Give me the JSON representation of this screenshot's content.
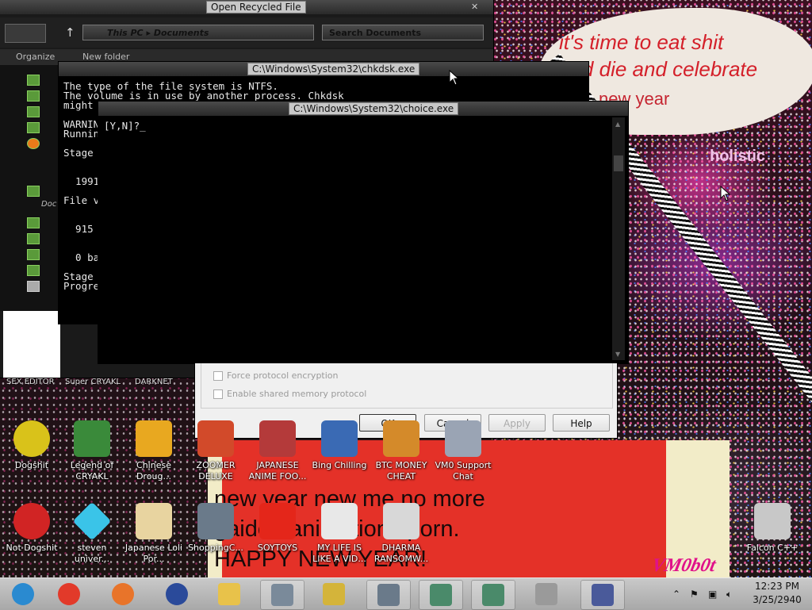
{
  "wallpaper": {
    "bubble_line1": "it's time to eat shit",
    "bubble_line2": "and die and celebrate",
    "bubble_line3": "new year",
    "holistic": "holistic",
    "sign_line1": "new year new me no more",
    "sign_line2": "gaiden animations porn.",
    "sign_line3": "HAPPY NEW YEAR!",
    "watermark": "VM0b0t"
  },
  "explorer": {
    "title": "Open Recycled File",
    "path_this_pc": "This PC",
    "path_sep": "▸",
    "path_documents": "Documents",
    "search_placeholder": "Search Documents",
    "organize": "Organize",
    "new_folder": "New folder",
    "nav_docs_label": "Doc"
  },
  "chkdsk": {
    "title": "C:\\Windows\\System32\\chkdsk.exe",
    "lines": [
      "The type of the file system is NTFS.",
      "The volume is in use by another process. Chkdsk",
      "might",
      "",
      "WARNIN",
      "Runnin",
      "",
      "Stage",
      "",
      "",
      "  1991",
      "",
      "File v",
      "",
      "",
      "  915",
      "",
      "",
      "  0 ba",
      "",
      "Stage",
      "Progre"
    ]
  },
  "choice": {
    "title": "C:\\Windows\\System32\\choice.exe",
    "prompt": "[Y,N]?_"
  },
  "dialog": {
    "options": [
      {
        "label": "Force protocol encryption",
        "checked": false
      },
      {
        "label": "Enable shared memory protocol",
        "checked": false
      }
    ],
    "ok": "OK",
    "cancel": "Cancel",
    "apply": "Apply",
    "help": "Help"
  },
  "desktop": {
    "hidden_row_labels": [
      "SEX EDITOR",
      "Super CRYAKL",
      "DARKNET"
    ],
    "icons": [
      {
        "label": "Dogshit",
        "icon": "dogshit-disc-icon",
        "color": "#d9c21a"
      },
      {
        "label": "Legend of CRYAKL",
        "icon": "pixel-character-icon",
        "color": "#3a8a3a"
      },
      {
        "label": "Chinese Droug...",
        "icon": "mahjong-tile-icon",
        "color": "#e8a820"
      },
      {
        "label": "ZOOMER DELUXE",
        "icon": "zoomer-icon",
        "color": "#d24a2a"
      },
      {
        "label": "JAPANESE ANIME FOO...",
        "icon": "anime-food-icon",
        "color": "#b43a3a"
      },
      {
        "label": "Bing Chilling",
        "icon": "bing-icon",
        "color": "#3a6ab4"
      },
      {
        "label": "BTC MONEY CHEAT",
        "icon": "bitcoin-icon",
        "color": "#d48a2a"
      },
      {
        "label": "VM0 Support Chat",
        "icon": "support-chat-icon",
        "color": "#9aa4b4"
      },
      {
        "label": "Not Dogshit",
        "icon": "devcpp-icon",
        "color": "#d12424"
      },
      {
        "label": "steven univer...",
        "icon": "diamond-icon",
        "color": "#3ac4e8"
      },
      {
        "label": "Japanese Loli Por...",
        "icon": "torii-tile-icon",
        "color": "#e8d4a0"
      },
      {
        "label": "ShoppingC...",
        "icon": "flash-player-icon",
        "color": "#6a7a8a"
      },
      {
        "label": "SOYTOYS",
        "icon": "soytoys-s-icon",
        "color": "#e4261a"
      },
      {
        "label": "MY LIFE IS LIKE A VID...",
        "icon": "gamepad-icon",
        "color": "#e8e8e8"
      },
      {
        "label": "DHARMA RANSOMW...",
        "icon": "skull-icon",
        "color": "#d8d8d8"
      },
      {
        "label": "Falcon C++",
        "icon": "recycle-bin-icon",
        "color": "#c8c8c8"
      }
    ]
  },
  "taskbar": {
    "apps": [
      {
        "name": "start-button",
        "icon": "start-orb-icon",
        "color": "#2a8ad0",
        "running": false
      },
      {
        "name": "chrome",
        "icon": "chrome-icon",
        "color": "#e23a2a",
        "running": false
      },
      {
        "name": "firefox",
        "icon": "firefox-icon",
        "color": "#e8742a",
        "running": false
      },
      {
        "name": "obama",
        "icon": "obama-logo-icon",
        "color": "#2a4a9a",
        "running": false
      },
      {
        "name": "explorer",
        "icon": "folder-icon",
        "color": "#e8c24a",
        "running": false
      },
      {
        "name": "calculator",
        "icon": "calculator-icon",
        "color": "#7a8a9a",
        "running": true
      },
      {
        "name": "keys",
        "icon": "keys-icon",
        "color": "#d4b43a",
        "running": false
      },
      {
        "name": "terminal",
        "icon": "terminal-icon",
        "color": "#6a7a8a",
        "running": true
      },
      {
        "name": "doc1",
        "icon": "window-icon",
        "color": "#4a8a6a",
        "running": true
      },
      {
        "name": "doc2",
        "icon": "window-icon",
        "color": "#4a8a6a",
        "running": true
      },
      {
        "name": "drive",
        "icon": "drive-icon",
        "color": "#9a9a9a",
        "running": false
      },
      {
        "name": "system",
        "icon": "system-monitor-icon",
        "color": "#4a5a9a",
        "running": true
      }
    ],
    "time": "12:23 PM",
    "date": "3/25/2940"
  }
}
